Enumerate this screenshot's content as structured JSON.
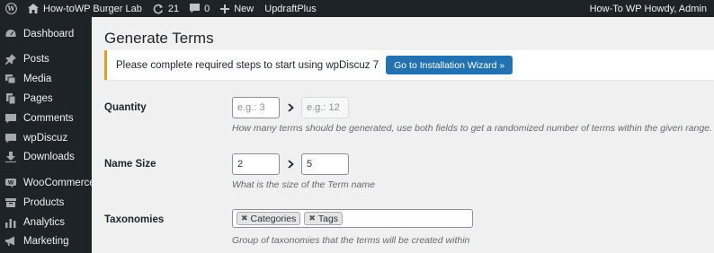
{
  "adminbar": {
    "site_name": "How-toWP Burger Lab",
    "updates_count": "21",
    "comments_count": "0",
    "new_label": "New",
    "plugin_label": "UpdraftPlus",
    "greeting": "How-To WP Howdy, Admin"
  },
  "sidebar": {
    "items": [
      {
        "label": "Dashboard",
        "icon": "dashboard-icon"
      },
      {
        "label": "Posts",
        "icon": "pin-icon"
      },
      {
        "label": "Media",
        "icon": "media-icon"
      },
      {
        "label": "Pages",
        "icon": "pages-icon"
      },
      {
        "label": "Comments",
        "icon": "comment-icon"
      },
      {
        "label": "wpDiscuz",
        "icon": "comment-icon"
      },
      {
        "label": "Downloads",
        "icon": "download-icon"
      },
      {
        "label": "WooCommerce",
        "icon": "woo-icon"
      },
      {
        "label": "Products",
        "icon": "products-icon"
      },
      {
        "label": "Analytics",
        "icon": "bar-chart-icon"
      },
      {
        "label": "Marketing",
        "icon": "megaphone-icon"
      }
    ]
  },
  "main": {
    "title": "Generate Terms",
    "notice": {
      "text": "Please complete required steps to start using wpDiscuz 7",
      "button_label": "Go to Installation Wizard »"
    },
    "quantity": {
      "label": "Quantity",
      "min_placeholder": "e.g.: 3",
      "max_placeholder": "e.g.: 12",
      "description": "How many terms should be generated, use both fields to get a randomized number of terms within the given range."
    },
    "name_size": {
      "label": "Name Size",
      "min_value": "2",
      "max_value": "5",
      "description": "What is the size of the Term name"
    },
    "taxonomies": {
      "label": "Taxonomies",
      "selected": [
        "Categories",
        "Tags"
      ],
      "description": "Group of taxonomies that the terms will be created within"
    }
  }
}
